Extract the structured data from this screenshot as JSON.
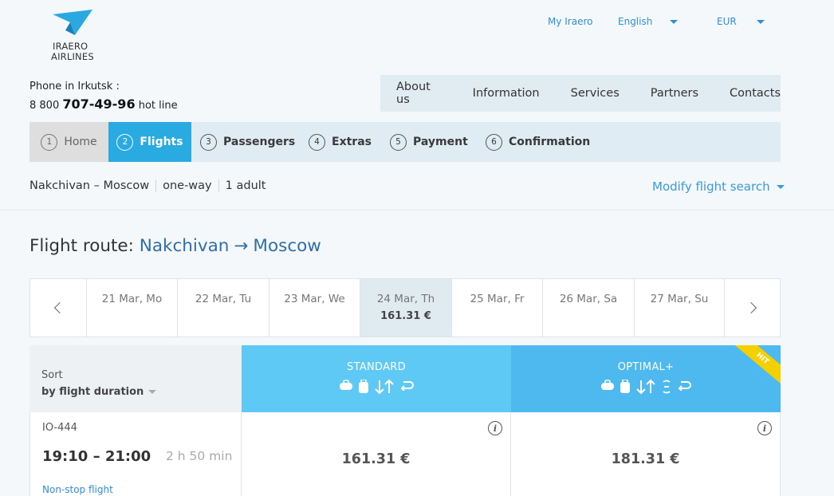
{
  "header": {
    "logo_line1": "IRAERO",
    "logo_line2": "AIRLINES",
    "my_account": "My Iraero",
    "language": "English",
    "currency": "EUR",
    "phone_label": "Phone in Irkutsk :",
    "phone_prefix": "8 800",
    "phone_number": "707-49-96",
    "phone_suffix": "hot line"
  },
  "nav": [
    "About us",
    "Information",
    "Services",
    "Partners",
    "Contacts"
  ],
  "steps": [
    {
      "num": "1",
      "label": "Home"
    },
    {
      "num": "2",
      "label": "Flights"
    },
    {
      "num": "3",
      "label": "Passengers"
    },
    {
      "num": "4",
      "label": "Extras"
    },
    {
      "num": "5",
      "label": "Payment"
    },
    {
      "num": "6",
      "label": "Confirmation"
    }
  ],
  "search": {
    "route": "Nakchivan – Moscow",
    "trip_type": "one-way",
    "passengers": "1 adult",
    "modify_label": "Modify flight search"
  },
  "route": {
    "label": "Flight route:",
    "from": "Nakchivan",
    "arrow": "→",
    "to": "Moscow"
  },
  "dates": [
    {
      "label": "21 Mar, Mo",
      "price": ""
    },
    {
      "label": "22 Mar, Tu",
      "price": ""
    },
    {
      "label": "23 Mar, We",
      "price": ""
    },
    {
      "label": "24 Mar, Th",
      "price": "161.31 €"
    },
    {
      "label": "25 Mar, Fr",
      "price": ""
    },
    {
      "label": "26 Mar, Sa",
      "price": ""
    },
    {
      "label": "27 Mar, Su",
      "price": ""
    }
  ],
  "sort": {
    "label": "Sort",
    "value": "by flight duration"
  },
  "tariffs": {
    "standard": "STANDARD",
    "optimal": "OPTIMAL+",
    "badge": "HIT"
  },
  "flight": {
    "number": "IO-444",
    "time": "19:10 – 21:00",
    "duration": "2 h 50 min",
    "stops": "Non-stop flight",
    "price_standard": "161.31 €",
    "price_optimal": "181.31 €"
  },
  "colors": {
    "accent": "#29abe2",
    "standard_bg": "#5fc9f6",
    "optimal_bg": "#4db9ef",
    "link": "#2f6ea6",
    "hit": "#f4d000"
  }
}
